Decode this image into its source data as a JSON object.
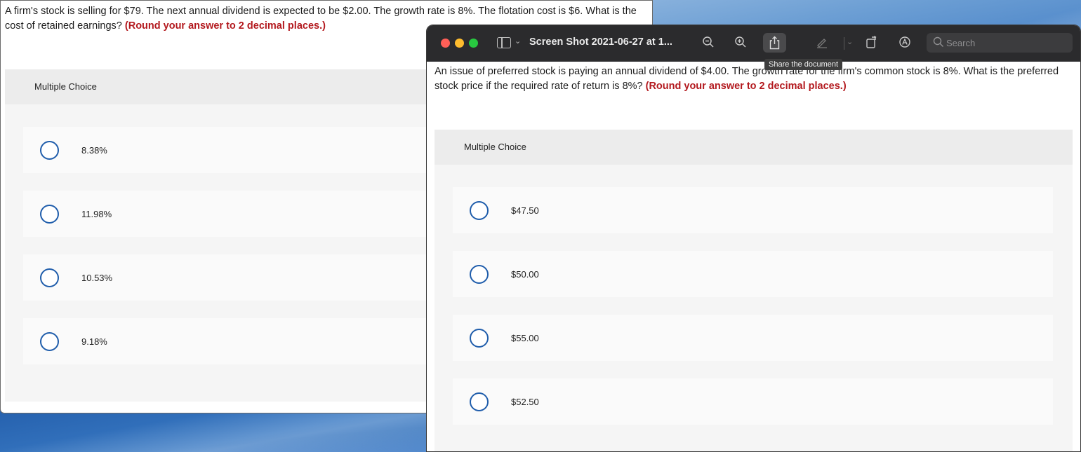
{
  "left_window": {
    "question_text": "A firm's stock is selling for $79. The next annual dividend is expected to be $2.00. The growth rate is 8%. The flotation cost is $6. What is the cost of retained earnings?",
    "instruction": "(Round your answer to 2 decimal places.)",
    "mc_header": "Multiple Choice",
    "options": [
      {
        "label": "8.38%"
      },
      {
        "label": "11.98%"
      },
      {
        "label": "10.53%"
      },
      {
        "label": "9.18%"
      }
    ]
  },
  "preview_window": {
    "title": "Screen Shot 2021-06-27 at 1...",
    "search": {
      "placeholder": "Search",
      "value": ""
    },
    "tooltip": "Share the document",
    "toolbar_icons": [
      "sidebar-icon",
      "chevron-down-icon",
      "zoom-out-icon",
      "zoom-in-icon",
      "share-icon",
      "markup-pen-icon",
      "chevron-down-icon",
      "rotate-icon",
      "annotate-icon",
      "search-icon"
    ],
    "question_text": "An issue of preferred stock is paying an annual dividend of $4.00. The growth rate for the firm's common stock is 8%. What is the preferred stock price if the required rate of return is 8%?",
    "instruction": "(Round your answer to 2 decimal places.)",
    "mc_header": "Multiple Choice",
    "options": [
      {
        "label": "$47.50"
      },
      {
        "label": "$50.00"
      },
      {
        "label": "$55.00"
      },
      {
        "label": "$52.50"
      }
    ]
  },
  "colors": {
    "accent_red": "#b3191e",
    "radio_blue": "#1f5dab",
    "titlebar": "#2b2b2d"
  }
}
